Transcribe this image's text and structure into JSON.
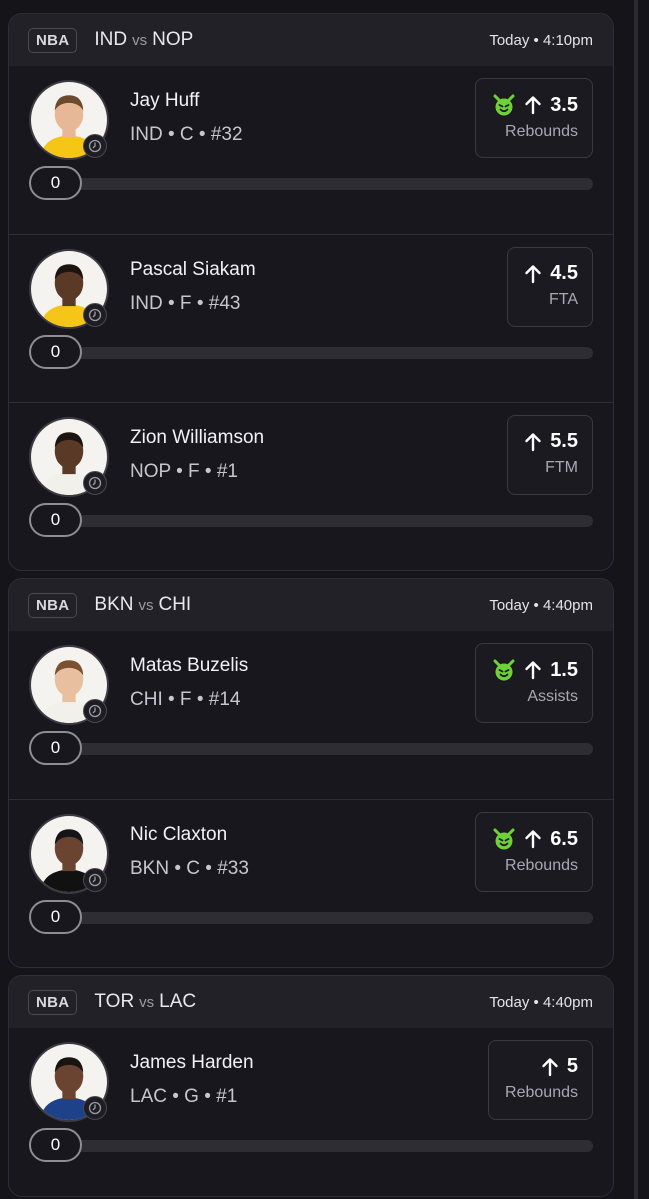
{
  "games": [
    {
      "league": "NBA",
      "home": "IND",
      "vs": "vs",
      "away": "NOP",
      "time": "Today • 4:10pm",
      "players": [
        {
          "name": "Jay Huff",
          "meta": "IND • C • #32",
          "line": "3.5",
          "stat": "Rebounds",
          "demon": true,
          "progress": "0",
          "progress_fraction": 0,
          "jersey": "#f5c518",
          "skin": "#e8b896",
          "hair": "#6b4a2e"
        },
        {
          "name": "Pascal Siakam",
          "meta": "IND • F • #43",
          "line": "4.5",
          "stat": "FTA",
          "demon": false,
          "progress": "0",
          "progress_fraction": 0,
          "jersey": "#f5c518",
          "skin": "#5a3a26",
          "hair": "#1c1410"
        },
        {
          "name": "Zion Williamson",
          "meta": "NOP • F • #1",
          "line": "5.5",
          "stat": "FTM",
          "demon": false,
          "progress": "0",
          "progress_fraction": 0,
          "jersey": "#f2f0ea",
          "skin": "#5a3a26",
          "hair": "#1c1410"
        }
      ]
    },
    {
      "league": "NBA",
      "home": "BKN",
      "vs": "vs",
      "away": "CHI",
      "time": "Today • 4:40pm",
      "players": [
        {
          "name": "Matas Buzelis",
          "meta": "CHI • F • #14",
          "line": "1.5",
          "stat": "Assists",
          "demon": true,
          "progress": "0",
          "progress_fraction": 0,
          "jersey": "#f2f0ea",
          "skin": "#e8c0a0",
          "hair": "#7a5232"
        },
        {
          "name": "Nic Claxton",
          "meta": "BKN • C • #33",
          "line": "6.5",
          "stat": "Rebounds",
          "demon": true,
          "progress": "0",
          "progress_fraction": 0,
          "jersey": "#111111",
          "skin": "#6a4430",
          "hair": "#151515"
        }
      ]
    },
    {
      "league": "NBA",
      "home": "TOR",
      "vs": "vs",
      "away": "LAC",
      "time": "Today • 4:40pm",
      "players": [
        {
          "name": "James Harden",
          "meta": "LAC • G • #1",
          "line": "5",
          "stat": "Rebounds",
          "demon": false,
          "progress": "0",
          "progress_fraction": 0,
          "jersey": "#1d428a",
          "skin": "#6a4430",
          "hair": "#1a1410"
        }
      ]
    }
  ],
  "colors": {
    "demon_green": "#6fd13a",
    "accent": "#ffffff"
  }
}
